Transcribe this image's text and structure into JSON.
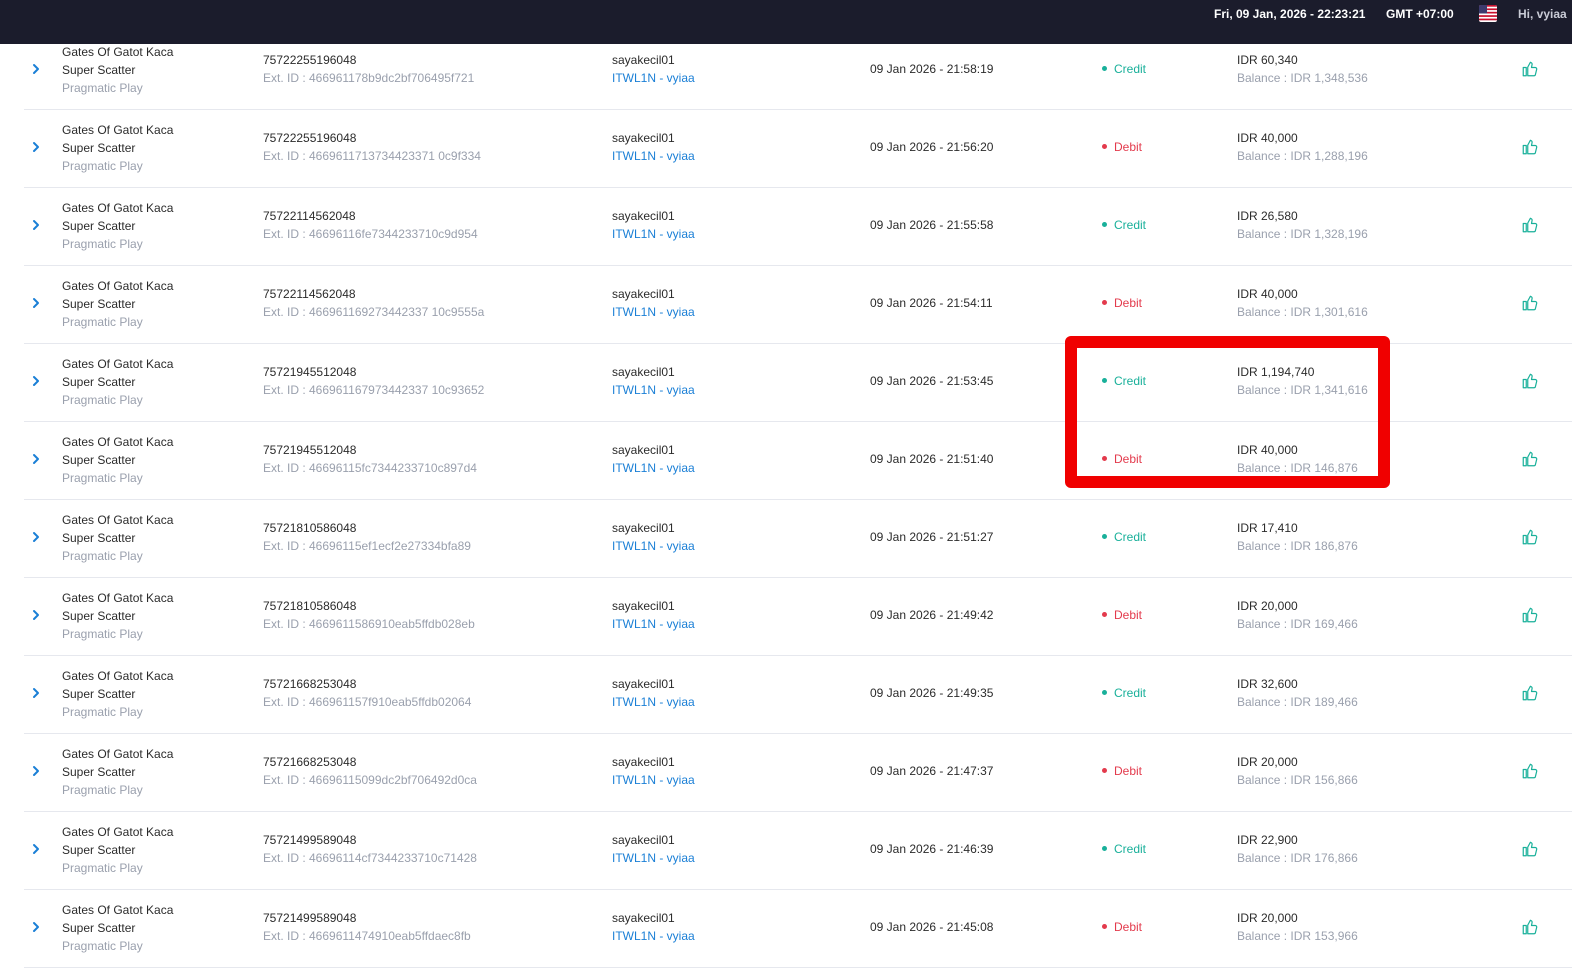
{
  "header": {
    "datetime": "Fri, 09 Jan, 2026 - 22:23:21",
    "timezone": "GMT +07:00",
    "greeting": "Hi, vyiaa"
  },
  "colors": {
    "topbar": "#1b1c2c",
    "credit": "#19b09a",
    "debit": "#e33a4c",
    "link": "#1a7fd6",
    "highlight": "#f00000"
  },
  "rows": [
    {
      "game": "Gates Of Gatot Kaca",
      "game_sub": "Super Scatter",
      "provider": "Pragmatic Play",
      "round_id": "75722255196048",
      "ext_id": "Ext. ID : 466961178b9dc2bf706495f721",
      "username": "sayakecil01",
      "agent": "ITWL1N - vyiaa",
      "datetime": "09 Jan 2026 - 21:58:19",
      "type": "Credit",
      "amount": "IDR 60,340",
      "balance": "Balance : IDR 1,348,536"
    },
    {
      "game": "Gates Of Gatot Kaca",
      "game_sub": "Super Scatter",
      "provider": "Pragmatic Play",
      "round_id": "75722255196048",
      "ext_id": "Ext. ID : 4669611713734423371 0c9f334",
      "username": "sayakecil01",
      "agent": "ITWL1N - vyiaa",
      "datetime": "09 Jan 2026 - 21:56:20",
      "type": "Debit",
      "amount": "IDR 40,000",
      "balance": "Balance : IDR 1,288,196"
    },
    {
      "game": "Gates Of Gatot Kaca",
      "game_sub": "Super Scatter",
      "provider": "Pragmatic Play",
      "round_id": "75722114562048",
      "ext_id": "Ext. ID : 46696116fe7344233710c9d954",
      "username": "sayakecil01",
      "agent": "ITWL1N - vyiaa",
      "datetime": "09 Jan 2026 - 21:55:58",
      "type": "Credit",
      "amount": "IDR 26,580",
      "balance": "Balance : IDR 1,328,196"
    },
    {
      "game": "Gates Of Gatot Kaca",
      "game_sub": "Super Scatter",
      "provider": "Pragmatic Play",
      "round_id": "75722114562048",
      "ext_id": "Ext. ID : 466961169273442337 10c9555a",
      "username": "sayakecil01",
      "agent": "ITWL1N - vyiaa",
      "datetime": "09 Jan 2026 - 21:54:11",
      "type": "Debit",
      "amount": "IDR 40,000",
      "balance": "Balance : IDR 1,301,616"
    },
    {
      "game": "Gates Of Gatot Kaca",
      "game_sub": "Super Scatter",
      "provider": "Pragmatic Play",
      "round_id": "75721945512048",
      "ext_id": "Ext. ID : 466961167973442337 10c93652",
      "username": "sayakecil01",
      "agent": "ITWL1N - vyiaa",
      "datetime": "09 Jan 2026 - 21:53:45",
      "type": "Credit",
      "amount": "IDR 1,194,740",
      "balance": "Balance : IDR 1,341,616"
    },
    {
      "game": "Gates Of Gatot Kaca",
      "game_sub": "Super Scatter",
      "provider": "Pragmatic Play",
      "round_id": "75721945512048",
      "ext_id": "Ext. ID : 46696115fc7344233710c897d4",
      "username": "sayakecil01",
      "agent": "ITWL1N - vyiaa",
      "datetime": "09 Jan 2026 - 21:51:40",
      "type": "Debit",
      "amount": "IDR 40,000",
      "balance": "Balance : IDR 146,876"
    },
    {
      "game": "Gates Of Gatot Kaca",
      "game_sub": "Super Scatter",
      "provider": "Pragmatic Play",
      "round_id": "75721810586048",
      "ext_id": "Ext. ID : 46696115ef1ecf2e27334bfa89",
      "username": "sayakecil01",
      "agent": "ITWL1N - vyiaa",
      "datetime": "09 Jan 2026 - 21:51:27",
      "type": "Credit",
      "amount": "IDR 17,410",
      "balance": "Balance : IDR 186,876"
    },
    {
      "game": "Gates Of Gatot Kaca",
      "game_sub": "Super Scatter",
      "provider": "Pragmatic Play",
      "round_id": "75721810586048",
      "ext_id": "Ext. ID : 4669611586910eab5ffdb028eb",
      "username": "sayakecil01",
      "agent": "ITWL1N - vyiaa",
      "datetime": "09 Jan 2026 - 21:49:42",
      "type": "Debit",
      "amount": "IDR 20,000",
      "balance": "Balance : IDR 169,466"
    },
    {
      "game": "Gates Of Gatot Kaca",
      "game_sub": "Super Scatter",
      "provider": "Pragmatic Play",
      "round_id": "75721668253048",
      "ext_id": "Ext. ID : 466961157f910eab5ffdb02064",
      "username": "sayakecil01",
      "agent": "ITWL1N - vyiaa",
      "datetime": "09 Jan 2026 - 21:49:35",
      "type": "Credit",
      "amount": "IDR 32,600",
      "balance": "Balance : IDR 189,466"
    },
    {
      "game": "Gates Of Gatot Kaca",
      "game_sub": "Super Scatter",
      "provider": "Pragmatic Play",
      "round_id": "75721668253048",
      "ext_id": "Ext. ID : 46696115099dc2bf706492d0ca",
      "username": "sayakecil01",
      "agent": "ITWL1N - vyiaa",
      "datetime": "09 Jan 2026 - 21:47:37",
      "type": "Debit",
      "amount": "IDR 20,000",
      "balance": "Balance : IDR 156,866"
    },
    {
      "game": "Gates Of Gatot Kaca",
      "game_sub": "Super Scatter",
      "provider": "Pragmatic Play",
      "round_id": "75721499589048",
      "ext_id": "Ext. ID : 46696114cf7344233710c71428",
      "username": "sayakecil01",
      "agent": "ITWL1N - vyiaa",
      "datetime": "09 Jan 2026 - 21:46:39",
      "type": "Credit",
      "amount": "IDR 22,900",
      "balance": "Balance : IDR 176,866"
    },
    {
      "game": "Gates Of Gatot Kaca",
      "game_sub": "Super Scatter",
      "provider": "Pragmatic Play",
      "round_id": "75721499589048",
      "ext_id": "Ext. ID : 4669611474910eab5ffdaec8fb",
      "username": "sayakecil01",
      "agent": "ITWL1N - vyiaa",
      "datetime": "09 Jan 2026 - 21:45:08",
      "type": "Debit",
      "amount": "IDR 20,000",
      "balance": "Balance : IDR 153,966"
    }
  ]
}
